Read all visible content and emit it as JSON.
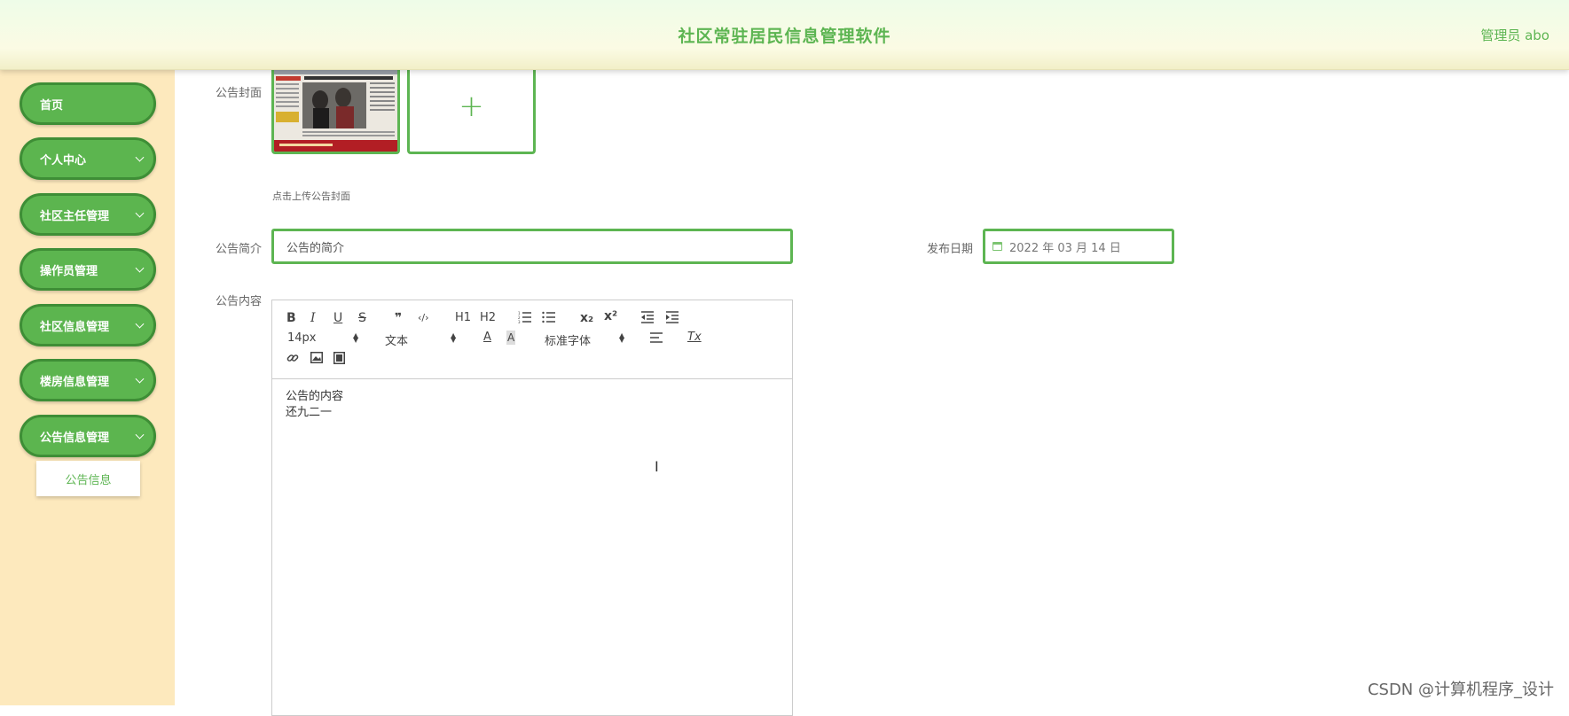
{
  "header": {
    "title": "社区常驻居民信息管理软件",
    "user": "管理员 abo"
  },
  "sidebar": {
    "items": [
      {
        "label": "首页",
        "has_chevron": false
      },
      {
        "label": "个人中心",
        "has_chevron": true
      },
      {
        "label": "社区主任管理",
        "has_chevron": true
      },
      {
        "label": "操作员管理",
        "has_chevron": true
      },
      {
        "label": "社区信息管理",
        "has_chevron": true
      },
      {
        "label": "楼房信息管理",
        "has_chevron": true
      },
      {
        "label": "公告信息管理",
        "has_chevron": true
      }
    ],
    "sub_item": "公告信息"
  },
  "form": {
    "cover_label": "公告封面",
    "upload_plus": "+",
    "upload_hint": "点击上传公告封面",
    "summary_label": "公告简介",
    "summary_value": "公告的简介",
    "date_label": "发布日期",
    "date_value": "2022 年 03 月 14 日",
    "content_label": "公告内容"
  },
  "editor": {
    "toolbar": {
      "bold": "B",
      "italic": "I",
      "underline": "U",
      "strike": "S",
      "quote": "❞",
      "code": "‹/›",
      "h1": "H1",
      "h2": "H2",
      "subscript": "x₂",
      "superscript": "x²",
      "size": "14px",
      "header": "文本",
      "font": "标准字体",
      "clean": "Tx"
    },
    "content_lines": [
      "公告的内容",
      "还九二一"
    ]
  },
  "watermark": "CSDN @计算机程序_设计",
  "colors": {
    "accent": "#5db552",
    "sidebar_bg": "#fde9bd",
    "button_border": "#3e8e36"
  }
}
